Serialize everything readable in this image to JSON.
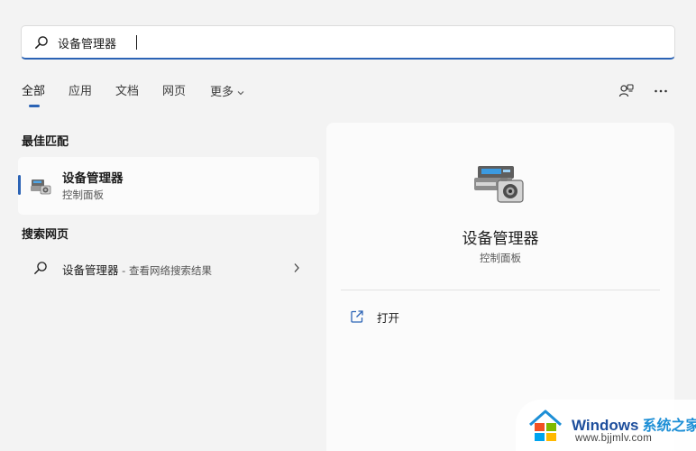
{
  "search": {
    "value": "设备管理器",
    "icon": "search-icon"
  },
  "tabs": [
    {
      "label": "全部",
      "active": true
    },
    {
      "label": "应用"
    },
    {
      "label": "文档"
    },
    {
      "label": "网页"
    },
    {
      "label": "更多"
    }
  ],
  "top_actions": {
    "share_icon": "account-share-icon",
    "more_icon": "ellipsis-icon"
  },
  "best_match": {
    "section_title": "最佳匹配",
    "name": "设备管理器",
    "subtitle": "控制面板",
    "icon": "device-manager-icon"
  },
  "web_search": {
    "section_title": "搜索网页",
    "query": "设备管理器",
    "hint": " - 查看网络搜索结果",
    "icon": "search-icon"
  },
  "detail": {
    "title": "设备管理器",
    "subtitle": "控制面板",
    "actions": [
      {
        "label": "打开",
        "icon": "open-external-icon"
      }
    ]
  },
  "watermark": {
    "brand": "Windows",
    "cn": "系统之家",
    "url": "www.bjjmlv.com"
  },
  "colors": {
    "accent": "#2b63b5",
    "background": "#f3f3f3",
    "card": "#fbfbfb"
  }
}
